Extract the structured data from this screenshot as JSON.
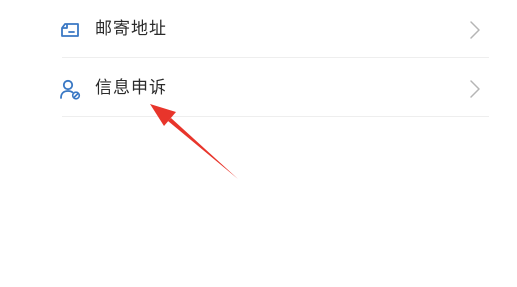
{
  "menu": {
    "items": [
      {
        "label": "邮寄地址",
        "icon": "mailbox-icon"
      },
      {
        "label": "信息申诉",
        "icon": "user-appeal-icon"
      }
    ]
  },
  "annotation": {
    "type": "arrow",
    "color": "#e8352b"
  }
}
